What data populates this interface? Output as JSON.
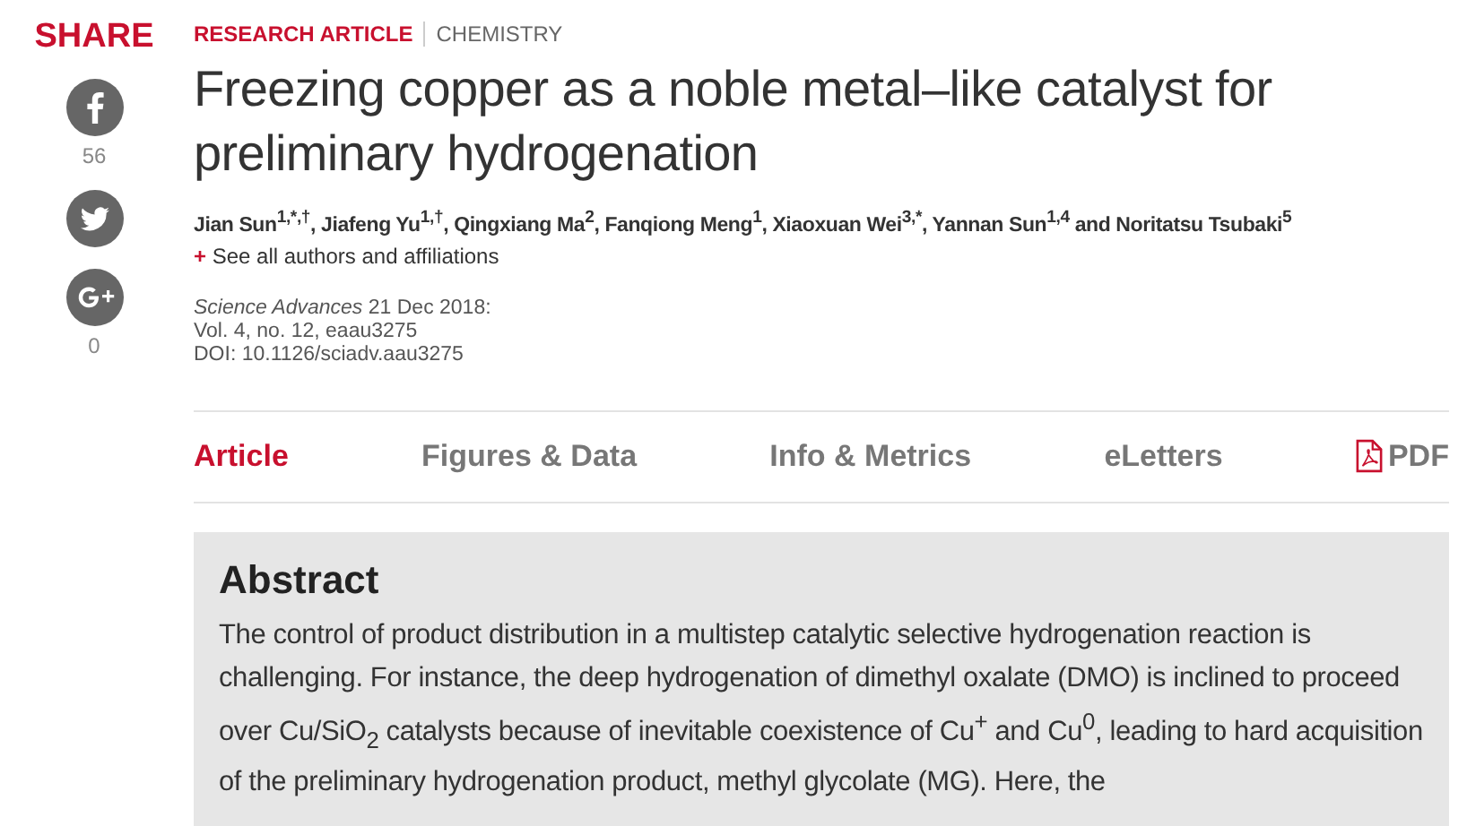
{
  "share": {
    "title": "SHARE",
    "items": [
      {
        "kind": "facebook",
        "count": "56"
      },
      {
        "kind": "twitter"
      },
      {
        "kind": "gplus",
        "count": "0"
      }
    ]
  },
  "article": {
    "type": "RESEARCH ARTICLE",
    "section": "CHEMISTRY",
    "title": "Freezing copper as a noble metal–like catalyst for preliminary hydrogenation",
    "authors": "Jian Sun$^{1,*,†}$, Jiafeng Yu$^{1,†}$, Qingxiang Ma$^{2}$, Fanqiong Meng$^{1}$, Xiaoxuan Wei$^{3,*}$, Yannan Sun$^{1,4}$ and Noritatsu Tsubaki$^{5}$",
    "affiliations_link": {
      "mark": "+",
      "label": "See all authors and affiliations"
    },
    "citation": [
      "*Science Advances*  21 Dec 2018:",
      "Vol. 4, no. 12, eaau3275",
      "DOI: 10.1126/sciadv.aau3275"
    ]
  },
  "tabs": [
    {
      "label": "Article",
      "selected": true,
      "kind": "text"
    },
    {
      "label": "Figures & Data",
      "selected": false,
      "kind": "text"
    },
    {
      "label": "Info & Metrics",
      "selected": false,
      "kind": "text"
    },
    {
      "label": "eLetters",
      "selected": false,
      "kind": "text"
    },
    {
      "label": "PDF",
      "selected": false,
      "kind": "pdf"
    }
  ],
  "abstract": {
    "heading": "Abstract",
    "text": "The control of product distribution in a multistep catalytic selective hydrogenation reaction is challenging. For instance, the deep hydrogenation of dimethyl oxalate (DMO) is inclined to proceed over Cu/SiO$_{2}$ catalysts because of inevitable coexistence of Cu$^{+}$ and Cu$^{0}$, leading to hard acquisition of the preliminary hydrogenation product, methyl glycolate (MG). Here, the"
  }
}
